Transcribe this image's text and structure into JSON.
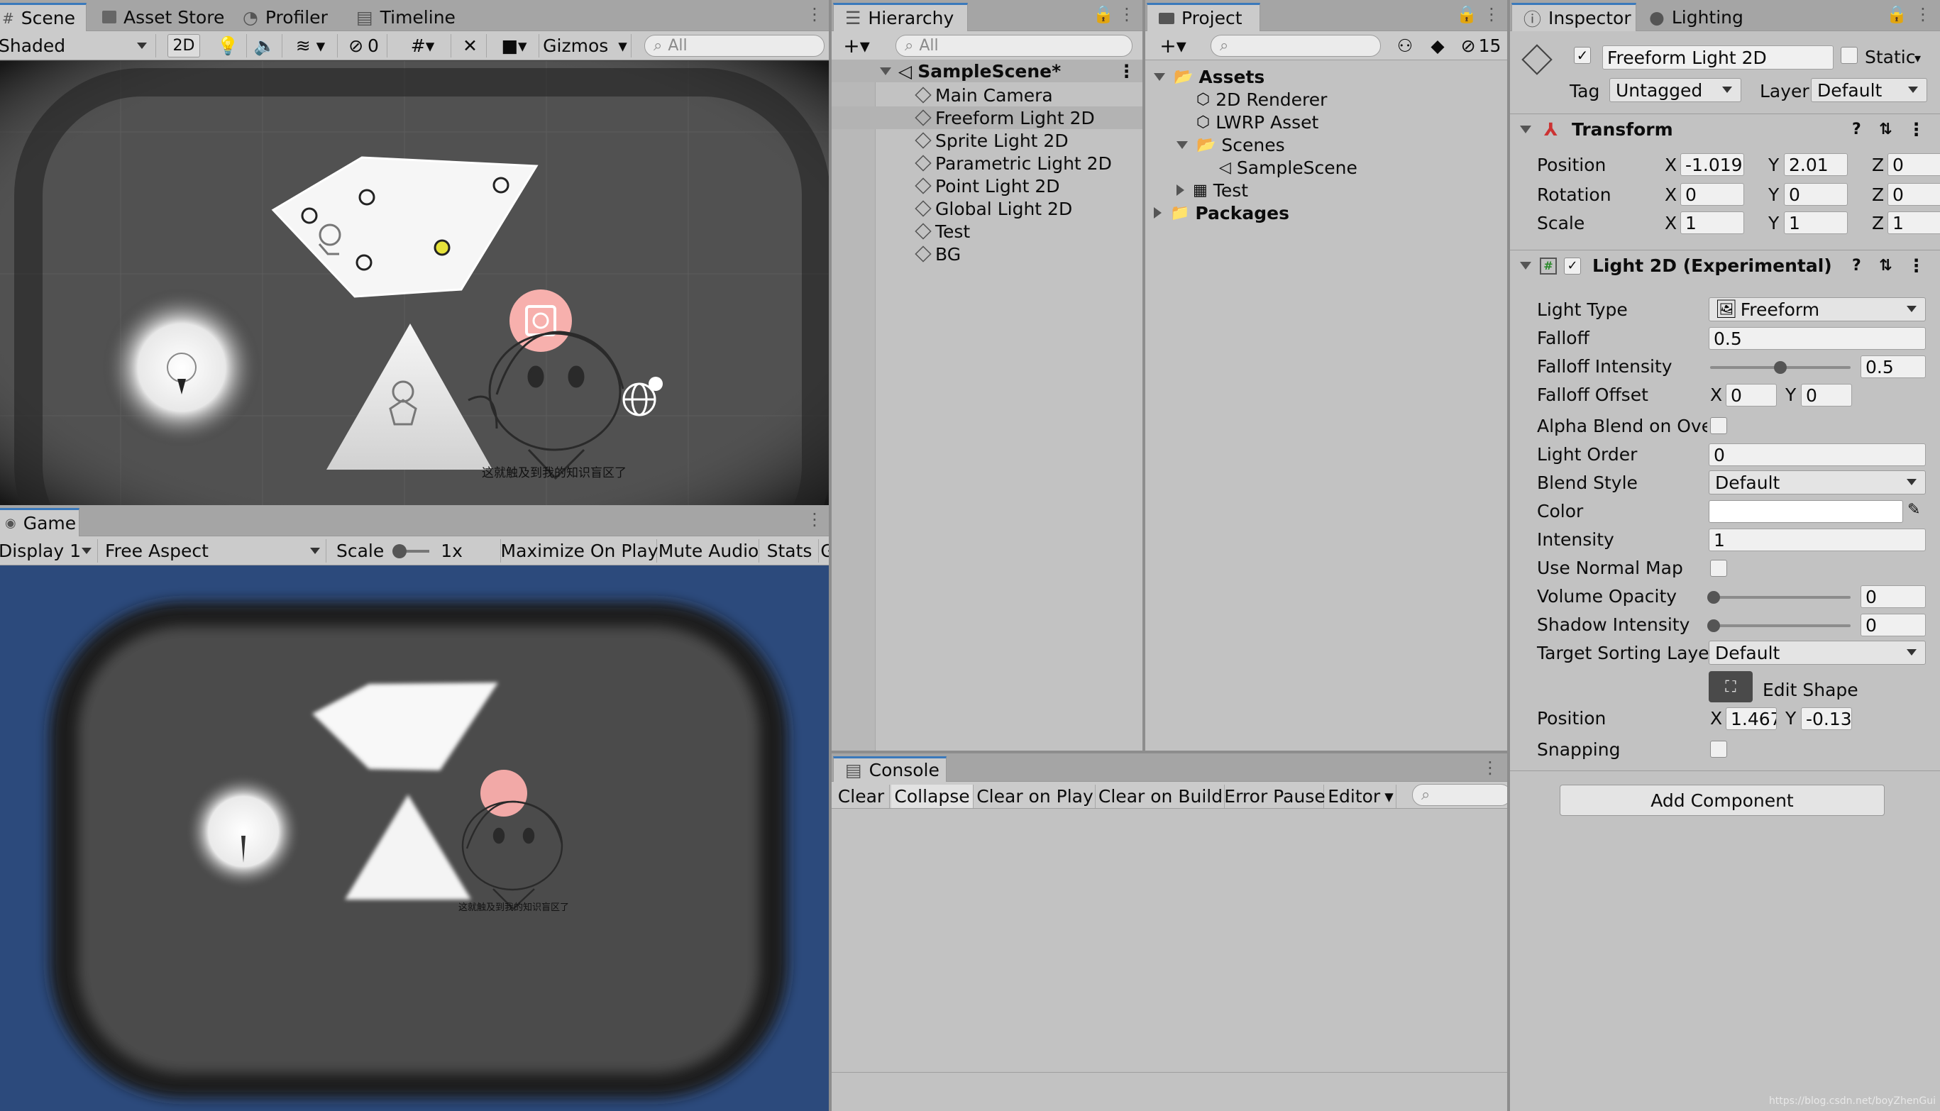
{
  "scene_view": {
    "tabs": [
      "Scene",
      "Asset Store",
      "Profiler",
      "Timeline"
    ],
    "shading_mode": "Shaded",
    "mode_2d": "2D",
    "hidden_count": "0",
    "gizmos_label": "Gizmos",
    "search_placeholder": "All",
    "canvas_caption": "这就触及到我的知识盲区了"
  },
  "game_view": {
    "tab": "Game",
    "display": "Display 1",
    "aspect": "Free Aspect",
    "scale_label": "Scale",
    "scale_value": "1x",
    "maximize": "Maximize On Play",
    "mute": "Mute Audio",
    "stats": "Stats",
    "gizmos_cut": "G",
    "canvas_caption": "这就触及到我的知识盲区了",
    "background_color": "#2c4a7c"
  },
  "hierarchy": {
    "tab": "Hierarchy",
    "search_placeholder": "All",
    "scene_name": "SampleScene*",
    "items": [
      "Main Camera",
      "Freeform Light 2D",
      "Sprite Light 2D",
      "Parametric Light 2D",
      "Point Light 2D",
      "Global Light 2D",
      "Test",
      "BG"
    ],
    "selected_index": 1
  },
  "project": {
    "tab": "Project",
    "hidden_count": "15",
    "tree": [
      {
        "label": "Assets",
        "bold": true,
        "depth": 0,
        "icon": "folder-open-icon"
      },
      {
        "label": "2D Renderer",
        "depth": 1,
        "icon": "asset-cube-icon"
      },
      {
        "label": "LWRP Asset",
        "depth": 1,
        "icon": "asset-cube-icon"
      },
      {
        "label": "Scenes",
        "depth": 1,
        "icon": "folder-open-icon"
      },
      {
        "label": "SampleScene",
        "depth": 2,
        "icon": "unity-scene-icon"
      },
      {
        "label": "Test",
        "depth": 1,
        "icon": "texture-icon"
      },
      {
        "label": "Packages",
        "bold": true,
        "depth": 0,
        "icon": "folder-icon"
      }
    ]
  },
  "console": {
    "tab": "Console",
    "buttons": [
      "Clear",
      "Collapse",
      "Clear on Play",
      "Clear on Build",
      "Error Pause",
      "Editor"
    ]
  },
  "inspector": {
    "tabs": [
      "Inspector",
      "Lighting"
    ],
    "object_name": "Freeform Light 2D",
    "static_label": "Static",
    "tag_label": "Tag",
    "tag_value": "Untagged",
    "layer_label": "Layer",
    "layer_value": "Default",
    "transform": {
      "title": "Transform",
      "position_label": "Position",
      "rotation_label": "Rotation",
      "scale_label": "Scale",
      "position": {
        "x": "-1.0190",
        "y": "2.01",
        "z": "0"
      },
      "rotation": {
        "x": "0",
        "y": "0",
        "z": "0"
      },
      "scale": {
        "x": "1",
        "y": "1",
        "z": "1"
      }
    },
    "light2d": {
      "title": "Light 2D (Experimental)",
      "light_type_label": "Light Type",
      "light_type": "Freeform",
      "falloff_label": "Falloff",
      "falloff": "0.5",
      "falloff_intensity_label": "Falloff Intensity",
      "falloff_intensity": "0.5",
      "falloff_intensity_fraction": 0.5,
      "falloff_offset_label": "Falloff Offset",
      "falloff_offset": {
        "x": "0",
        "y": "0"
      },
      "alpha_blend_label": "Alpha Blend on Overl",
      "light_order_label": "Light Order",
      "light_order": "0",
      "blend_style_label": "Blend Style",
      "blend_style": "Default",
      "color_label": "Color",
      "color": "#ffffff",
      "intensity_label": "Intensity",
      "intensity": "1",
      "normal_map_label": "Use Normal Map",
      "volume_opacity_label": "Volume Opacity",
      "volume_opacity": "0",
      "shadow_intensity_label": "Shadow Intensity",
      "shadow_intensity": "0",
      "target_sorting_label": "Target Sorting Layers",
      "target_sorting": "Default",
      "edit_shape_label": "Edit Shape",
      "shape_position_label": "Position",
      "shape_position": {
        "x": "1.467",
        "y": "-0.13"
      },
      "snapping_label": "Snapping"
    },
    "add_component": "Add Component"
  },
  "axis": {
    "x": "X",
    "y": "Y",
    "z": "Z"
  },
  "watermark": "https://blog.csdn.net/boyZhenGui"
}
